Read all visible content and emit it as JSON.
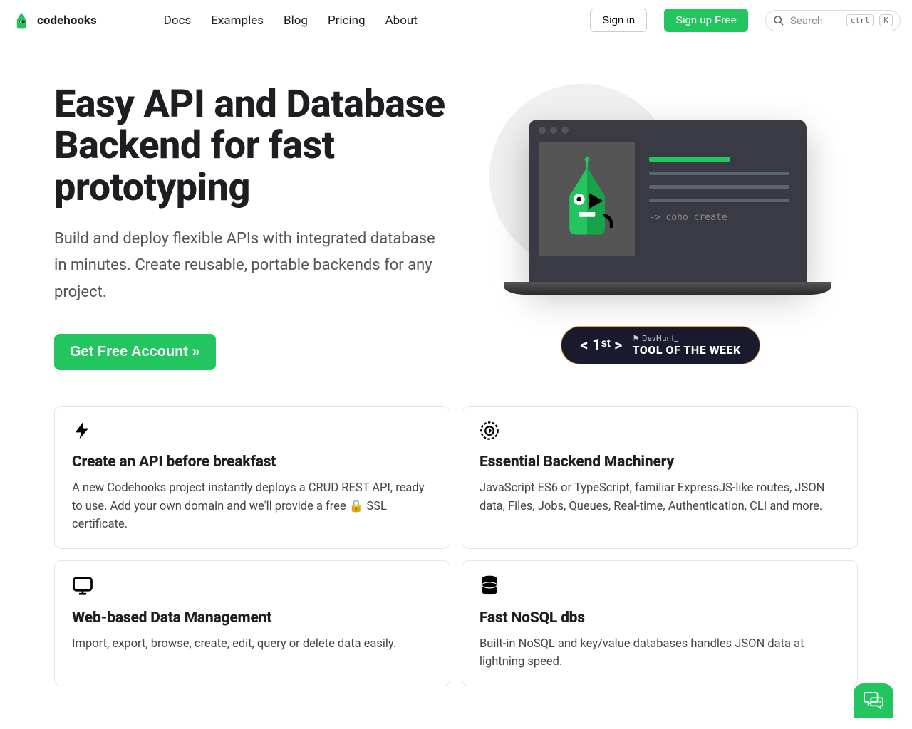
{
  "brand": {
    "name": "codehooks"
  },
  "nav": {
    "links": [
      "Docs",
      "Examples",
      "Blog",
      "Pricing",
      "About"
    ],
    "signin": "Sign in",
    "signup": "Sign up Free"
  },
  "search": {
    "placeholder": "Search",
    "kbd1": "ctrl",
    "kbd2": "K"
  },
  "hero": {
    "title": "Easy API and Database Backend for fast prototyping",
    "subtitle": "Build and deploy flexible APIs with integrated database in minutes. Create reusable, portable backends for any project.",
    "cta": "Get Free Account »",
    "terminal": "-> coho create|"
  },
  "tow": {
    "rank": "< 1ˢᵗ >",
    "devhunt": "⚑ DevHunt_",
    "label": "TOOL OF THE WEEK"
  },
  "features": [
    {
      "icon": "bolt-icon",
      "title": "Create an API before breakfast",
      "body": "A new Codehooks project instantly deploys a CRUD REST API, ready to use. Add your own domain and we'll provide a free 🔒 SSL certificate."
    },
    {
      "icon": "gear-icon",
      "title": "Essential Backend Machinery",
      "body": "JavaScript ES6 or TypeScript, familiar ExpressJS-like routes, JSON data, Files, Jobs, Queues, Real-time, Authentication, CLI and more."
    },
    {
      "icon": "monitor-icon",
      "title": "Web-based Data Management",
      "body": "Import, export, browse, create, edit, query or delete data easily."
    },
    {
      "icon": "database-icon",
      "title": "Fast NoSQL dbs",
      "body": "Built-in NoSQL and key/value databases handles JSON data at lightning speed."
    }
  ]
}
